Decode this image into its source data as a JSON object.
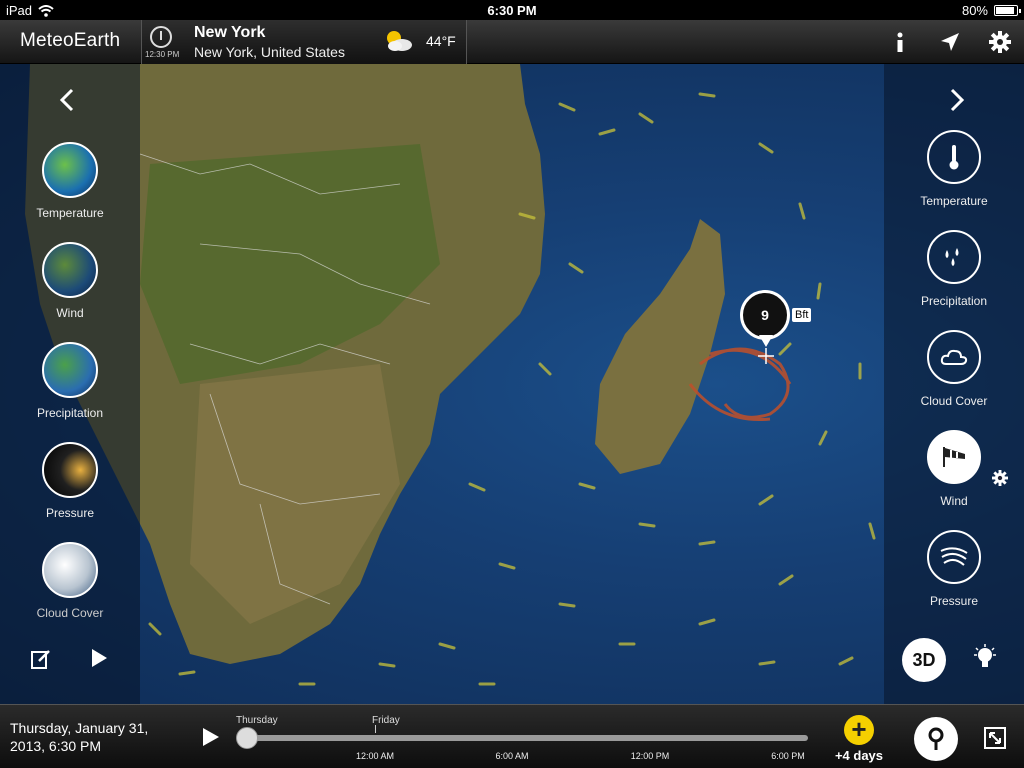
{
  "status": {
    "device": "iPad",
    "time": "6:30 PM",
    "battery": "80%",
    "battery_level": 0.8
  },
  "topbar": {
    "brand": "MeteoEarth",
    "location_time": "12:30 PM",
    "city": "New York",
    "country": "New York, United States",
    "weather_icon": "partly-cloudy-icon",
    "temperature": "44°F",
    "icons": [
      "info-icon",
      "location-arrow-icon",
      "gear-icon"
    ]
  },
  "left_panel": {
    "layers": [
      {
        "label": "Temperature"
      },
      {
        "label": "Wind"
      },
      {
        "label": "Precipitation"
      },
      {
        "label": "Pressure"
      },
      {
        "label": "Cloud Cover"
      }
    ],
    "bottom_icons": [
      "edit-icon",
      "play-icon"
    ]
  },
  "right_panel": {
    "layers": [
      {
        "label": "Temperature",
        "icon": "thermometer-icon"
      },
      {
        "label": "Precipitation",
        "icon": "raindrops-icon"
      },
      {
        "label": "Cloud Cover",
        "icon": "cloud-icon"
      },
      {
        "label": "Wind",
        "icon": "windsock-icon",
        "active": true
      },
      {
        "label": "Pressure",
        "icon": "isobars-icon"
      }
    ],
    "view_3d": "3D",
    "bottom_icon": "lightbulb-icon"
  },
  "marker": {
    "value": "9",
    "unit": "Bft"
  },
  "timeline": {
    "date_line1": "Thursday, January 31,",
    "date_line2": "2013, 6:30 PM",
    "days": [
      "Thursday",
      "Friday"
    ],
    "ticks": [
      "12:00 AM",
      "6:00 AM",
      "12:00 PM",
      "6:00 PM"
    ],
    "plus_days": "+4 days"
  },
  "colors": {
    "ocean": "#163f74",
    "land": "#6b6a3a",
    "wind_particles": "#c8c23a",
    "cyclone": "#c0502a",
    "accent": "#f5d000"
  }
}
